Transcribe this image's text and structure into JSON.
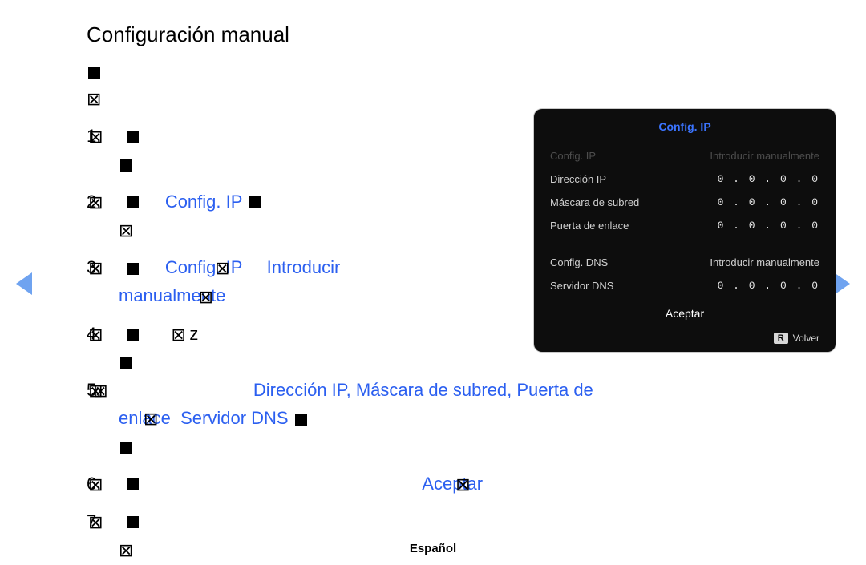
{
  "page": {
    "title": "Configuración manual",
    "language_footer": "Español"
  },
  "steps": {
    "s1": "1.",
    "s2": "2.",
    "s2_hl": "Config. IP",
    "s3": "3.",
    "s3_hl_a": "Config. IP",
    "s3_hl_b": "Introducir",
    "s3_hl_c": "manualmente",
    "s4": "4.",
    "s4_glyph": "z",
    "s5": "5.",
    "s5_hl_a": "Dirección IP, Máscara de subred, Puerta de",
    "s5_hl_b": "enlace",
    "s5_hl_c": "Servidor DNS",
    "s6": "6.",
    "s6_hl": "Aceptar",
    "s7": "7."
  },
  "panel": {
    "title": "Config. IP",
    "rows": {
      "cfg_ip_label": "Config. IP",
      "cfg_ip_value": "Introducir manualmente",
      "ip_label": "Dirección IP",
      "ip_value": "0 . 0 . 0 . 0",
      "mask_label": "Máscara de subred",
      "mask_value": "0 . 0 . 0 . 0",
      "gw_label": "Puerta de enlace",
      "gw_value": "0 . 0 . 0 . 0",
      "cfg_dns_label": "Config. DNS",
      "cfg_dns_value": "Introducir manualmente",
      "dns_label": "Servidor DNS",
      "dns_value": "0 . 0 . 0 . 0"
    },
    "accept": "Aceptar",
    "back_key": "R",
    "back_label": "Volver"
  }
}
